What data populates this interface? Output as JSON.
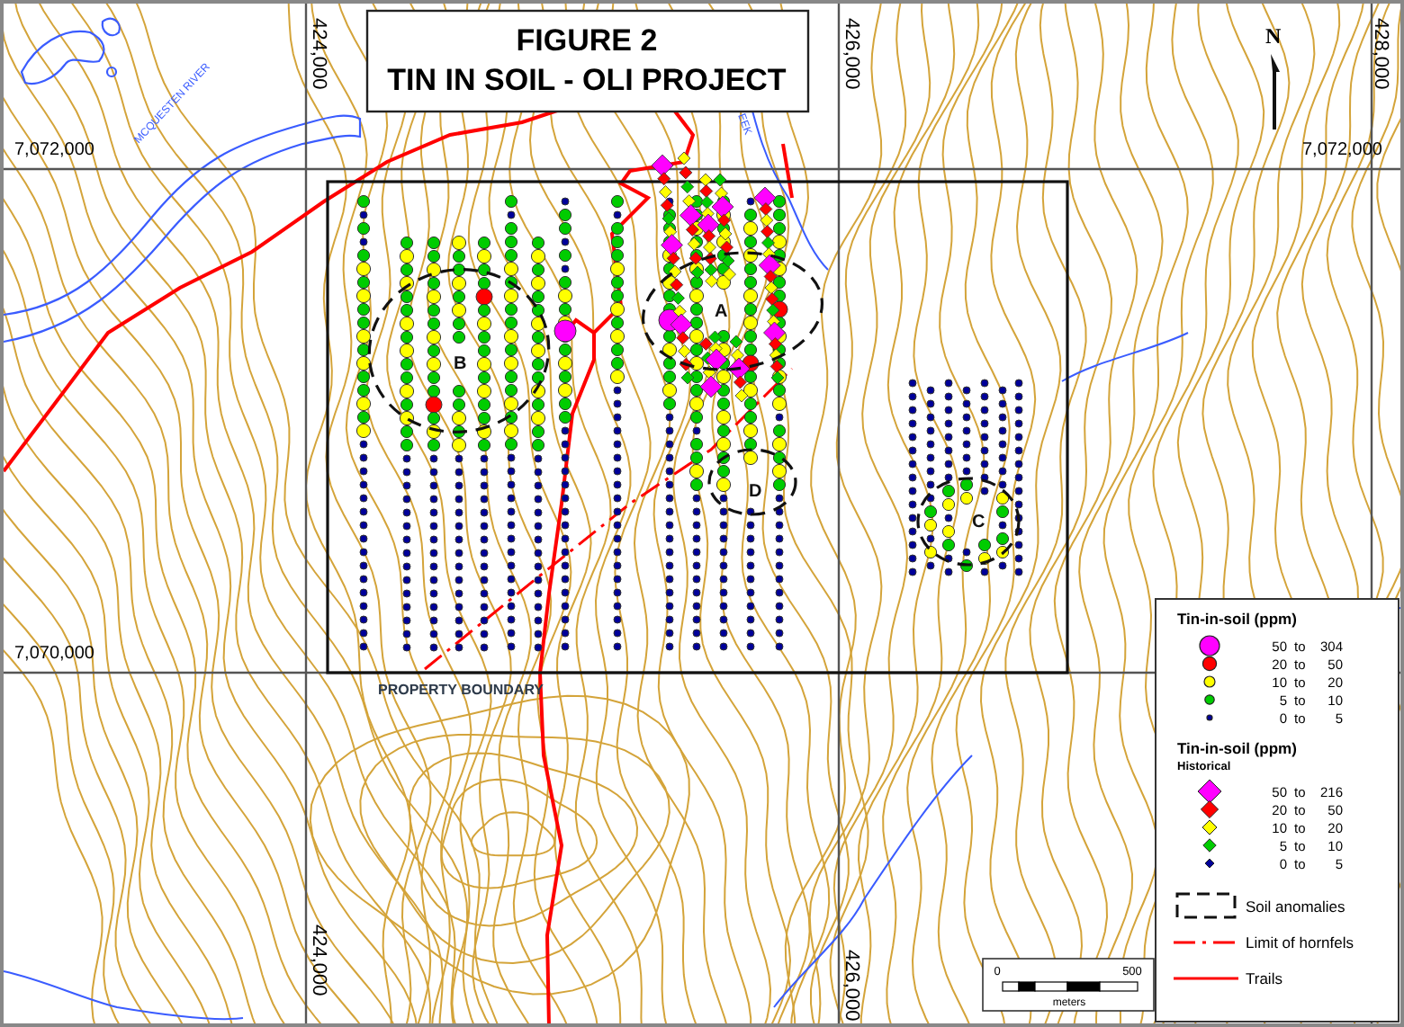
{
  "title": {
    "lines": [
      "FIGURE 2",
      "TIN IN SOIL - OLI PROJECT"
    ]
  },
  "north_arrow": {
    "label": "N"
  },
  "grid_labels": [
    {
      "text": "424,000"
    },
    {
      "text": "426,000"
    },
    {
      "text": "428,000"
    },
    {
      "text": "424,000"
    },
    {
      "text": "426,000"
    },
    {
      "text": "7,072,000"
    },
    {
      "text": "7,072,000"
    },
    {
      "text": "7,070,000"
    }
  ],
  "map_labels": [
    {
      "kind": "river",
      "text": "MCQUESTEN RIVER"
    },
    {
      "kind": "creek",
      "text": "EEK"
    },
    {
      "kind": "boundary",
      "text": "PROPERTY BOUNDARY"
    },
    {
      "kind": "anomaly",
      "text": "A"
    },
    {
      "kind": "anomaly",
      "text": "B"
    },
    {
      "kind": "anomaly",
      "text": "C"
    },
    {
      "kind": "anomaly",
      "text": "D"
    }
  ],
  "legend": {
    "sections": [
      {
        "heading": "Tin-in-soil (ppm)",
        "items": [
          {
            "kind": "circle",
            "min": "50",
            "sep": "to",
            "max": "304",
            "color": "#ff00ff"
          },
          {
            "kind": "circle",
            "min": "20",
            "sep": "to",
            "max": "50",
            "color": "#ff0000"
          },
          {
            "kind": "circle",
            "min": "10",
            "sep": "to",
            "max": "20",
            "color": "#ffff00"
          },
          {
            "kind": "circle",
            "min": "5",
            "sep": "to",
            "max": "10",
            "color": "#00cc00"
          },
          {
            "kind": "circle",
            "min": "0",
            "sep": "to",
            "max": "5",
            "color": "#000099"
          }
        ]
      },
      {
        "heading": "Tin-in-soil (ppm)",
        "subheading": "Historical",
        "items": [
          {
            "kind": "diamond",
            "min": "50",
            "sep": "to",
            "max": "216",
            "color": "#ff00ff"
          },
          {
            "kind": "diamond",
            "min": "20",
            "sep": "to",
            "max": "50",
            "color": "#ff0000"
          },
          {
            "kind": "diamond",
            "min": "10",
            "sep": "to",
            "max": "20",
            "color": "#ffff00"
          },
          {
            "kind": "diamond",
            "min": "5",
            "sep": "to",
            "max": "10",
            "color": "#00cc00"
          },
          {
            "kind": "diamond",
            "min": "0",
            "sep": "to",
            "max": "5",
            "color": "#000099"
          }
        ]
      }
    ],
    "lines": [
      {
        "kind": "dashed-box",
        "label": "Soil anomalies"
      },
      {
        "kind": "dash-dot",
        "label": "Limit of hornfels"
      },
      {
        "kind": "solid",
        "label": "Trails"
      }
    ]
  },
  "scale_bar": {
    "start": "0",
    "end": "500",
    "unit": "meters"
  }
}
